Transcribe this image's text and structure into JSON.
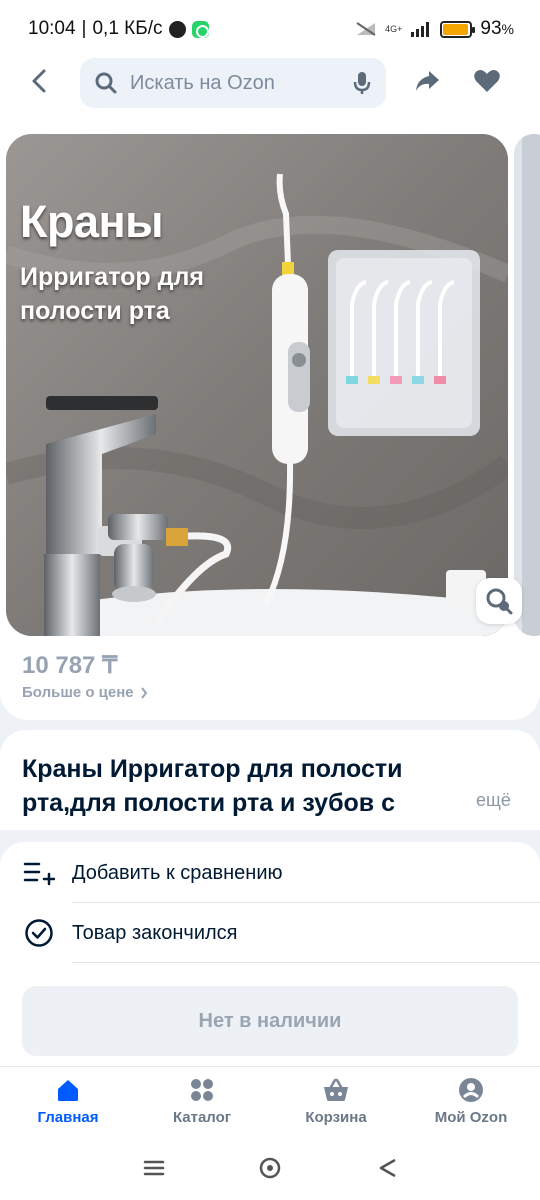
{
  "status_bar": {
    "time": "10:04",
    "separator": "|",
    "speed": "0,1 КБ/с",
    "network": "4G+",
    "battery": "93",
    "battery_unit": "%",
    "battery_level": 0.93
  },
  "header": {
    "search_placeholder": "Искать на Ozon",
    "icons": [
      "back-arrow-icon",
      "search-icon",
      "microphone-icon",
      "share-icon",
      "heart-icon"
    ]
  },
  "gallery": {
    "headline": "Краны",
    "subline": "Ирригатор для полости рта",
    "icons": [
      "visual-search-icon"
    ]
  },
  "price": {
    "amount": "10 787 ₸",
    "more_link": "Больше о цене"
  },
  "product": {
    "title": "Краны Ирригатор для полости рта,для полости рта и зубов с",
    "more_label": "ещё"
  },
  "actions": [
    {
      "label": "Добавить к сравнению",
      "icon": "compare-list-icon"
    },
    {
      "label": "Товар закончился",
      "icon": "check-circle-icon"
    }
  ],
  "stock_button": {
    "label": "Нет в наличии"
  },
  "bottom_nav": [
    {
      "label": "Главная",
      "icon": "home-icon",
      "active": true
    },
    {
      "label": "Каталог",
      "icon": "catalog-icon",
      "active": false
    },
    {
      "label": "Корзина",
      "icon": "cart-icon",
      "active": false
    },
    {
      "label": "Мой Ozon",
      "icon": "profile-icon",
      "active": false
    }
  ],
  "colors": {
    "accent": "#005bff",
    "text": "#001a34",
    "muted": "#97a3b3",
    "battery": "#f5a500"
  }
}
